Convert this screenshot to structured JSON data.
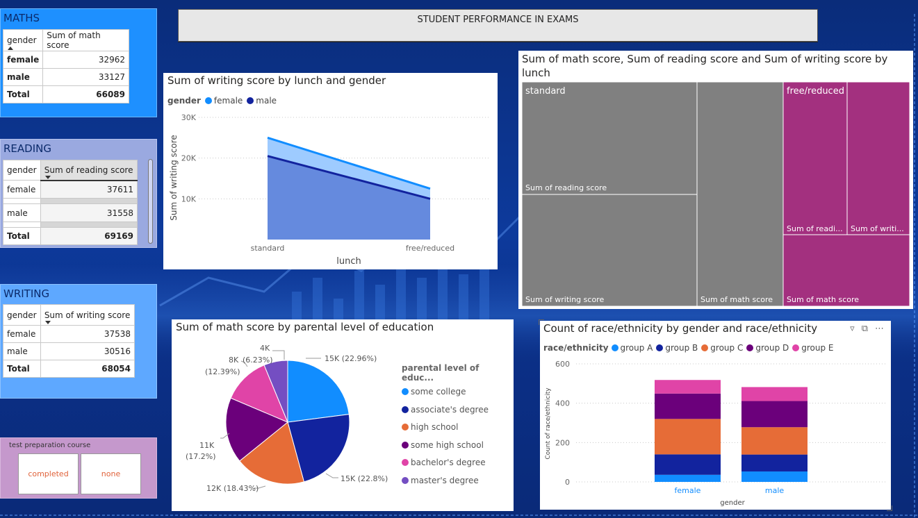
{
  "header": {
    "title": "STUDENT PERFORMANCE IN EXAMS"
  },
  "maths": {
    "title": "MATHS",
    "col_gender": "gender",
    "col_score": "Sum of math score",
    "rows": [
      {
        "label": "female",
        "value": "32962"
      },
      {
        "label": "male",
        "value": "33127"
      }
    ],
    "total_label": "Total",
    "total_value": "66089"
  },
  "reading": {
    "title": "READING",
    "col_gender": "gender",
    "col_score": "Sum of reading score",
    "rows": [
      {
        "label": "female",
        "value": "37611"
      },
      {
        "label": "male",
        "value": "31558"
      }
    ],
    "total_label": "Total",
    "total_value": "69169"
  },
  "writing": {
    "title": "WRITING",
    "col_gender": "gender",
    "col_score": "Sum of writing score",
    "rows": [
      {
        "label": "female",
        "value": "37538"
      },
      {
        "label": "male",
        "value": "30516"
      }
    ],
    "total_label": "Total",
    "total_value": "68054"
  },
  "slicer": {
    "title": "test preparation course",
    "options": [
      "completed",
      "none"
    ]
  },
  "line_chart": {
    "title": "Sum of writing score by lunch and gender",
    "legend_title": "gender",
    "legend": [
      "female",
      "male"
    ],
    "ylabel": "Sum of writing score",
    "xlabel": "lunch",
    "yticks": [
      "30K",
      "20K",
      "10K"
    ],
    "xticks": [
      "standard",
      "free/reduced"
    ]
  },
  "treemap": {
    "title": "Sum of math score, Sum of reading score and Sum of writing score by lunch",
    "group1": "standard",
    "group2": "free/reduced",
    "tiles": {
      "std_reading": "Sum of reading score",
      "std_writing": "Sum of writing score",
      "std_math": "Sum of math score",
      "fr_reading": "Sum of readi...",
      "fr_writing": "Sum of writi...",
      "fr_math": "Sum of math score"
    }
  },
  "pie": {
    "title": "Sum of math score by parental level of education",
    "legend_title": "parental level of educ...",
    "labels": {
      "some_college": "15K (22.96%)",
      "associates": "15K (22.8%)",
      "high_school": "12K (18.43%)",
      "some_high_school_a": "11K",
      "some_high_school_b": "(17.2%)",
      "bachelors_a": "8K",
      "bachelors_b": "(12.39%)",
      "masters_a": "4K",
      "masters_b": "(6.23%)"
    }
  },
  "bar": {
    "title": "Count of race/ethnicity by gender and race/ethnicity",
    "legend_title": "race/ethnicity",
    "ylabel": "Count of race/ethnicity",
    "xlabel": "gender",
    "yticks": [
      "600",
      "400",
      "200",
      "0"
    ]
  },
  "colors": {
    "accent_blue": "#118dff",
    "dark_blue": "#12239e",
    "orange": "#e66c37",
    "purple": "#6b007b",
    "pink": "#e044a7",
    "violet": "#744ec2",
    "treemap_grey": "#808080",
    "treemap_magenta": "#a3307f"
  },
  "chart_data": [
    {
      "type": "area",
      "title": "Sum of writing score by lunch and gender",
      "xlabel": "lunch",
      "ylabel": "Sum of writing score",
      "categories": [
        "standard",
        "free/reduced"
      ],
      "series": [
        {
          "name": "female",
          "values": [
            25000,
            12500
          ]
        },
        {
          "name": "male",
          "values": [
            20500,
            10000
          ]
        }
      ],
      "ylim": [
        0,
        30000
      ],
      "grid": true,
      "legend_placement": "top-left"
    },
    {
      "type": "pie",
      "title": "Sum of math score by parental level of education",
      "categories": [
        "some college",
        "associate's degree",
        "high school",
        "some high school",
        "bachelor's degree",
        "master's degree"
      ],
      "values": [
        22.96,
        22.8,
        18.43,
        17.2,
        12.39,
        6.23
      ],
      "legend_placement": "right"
    },
    {
      "type": "bar",
      "title": "Count of race/ethnicity by gender and race/ethnicity",
      "xlabel": "gender",
      "ylabel": "Count of race/ethnicity",
      "categories": [
        "female",
        "male"
      ],
      "series": [
        {
          "name": "group A",
          "values": [
            36,
            53
          ]
        },
        {
          "name": "group B",
          "values": [
            104,
            86
          ]
        },
        {
          "name": "group C",
          "values": [
            180,
            139
          ]
        },
        {
          "name": "group D",
          "values": [
            129,
            133
          ]
        },
        {
          "name": "group E",
          "values": [
            69,
            71
          ]
        }
      ],
      "stacked": true,
      "ylim": [
        0,
        600
      ],
      "grid": true,
      "legend_placement": "top-left"
    }
  ]
}
